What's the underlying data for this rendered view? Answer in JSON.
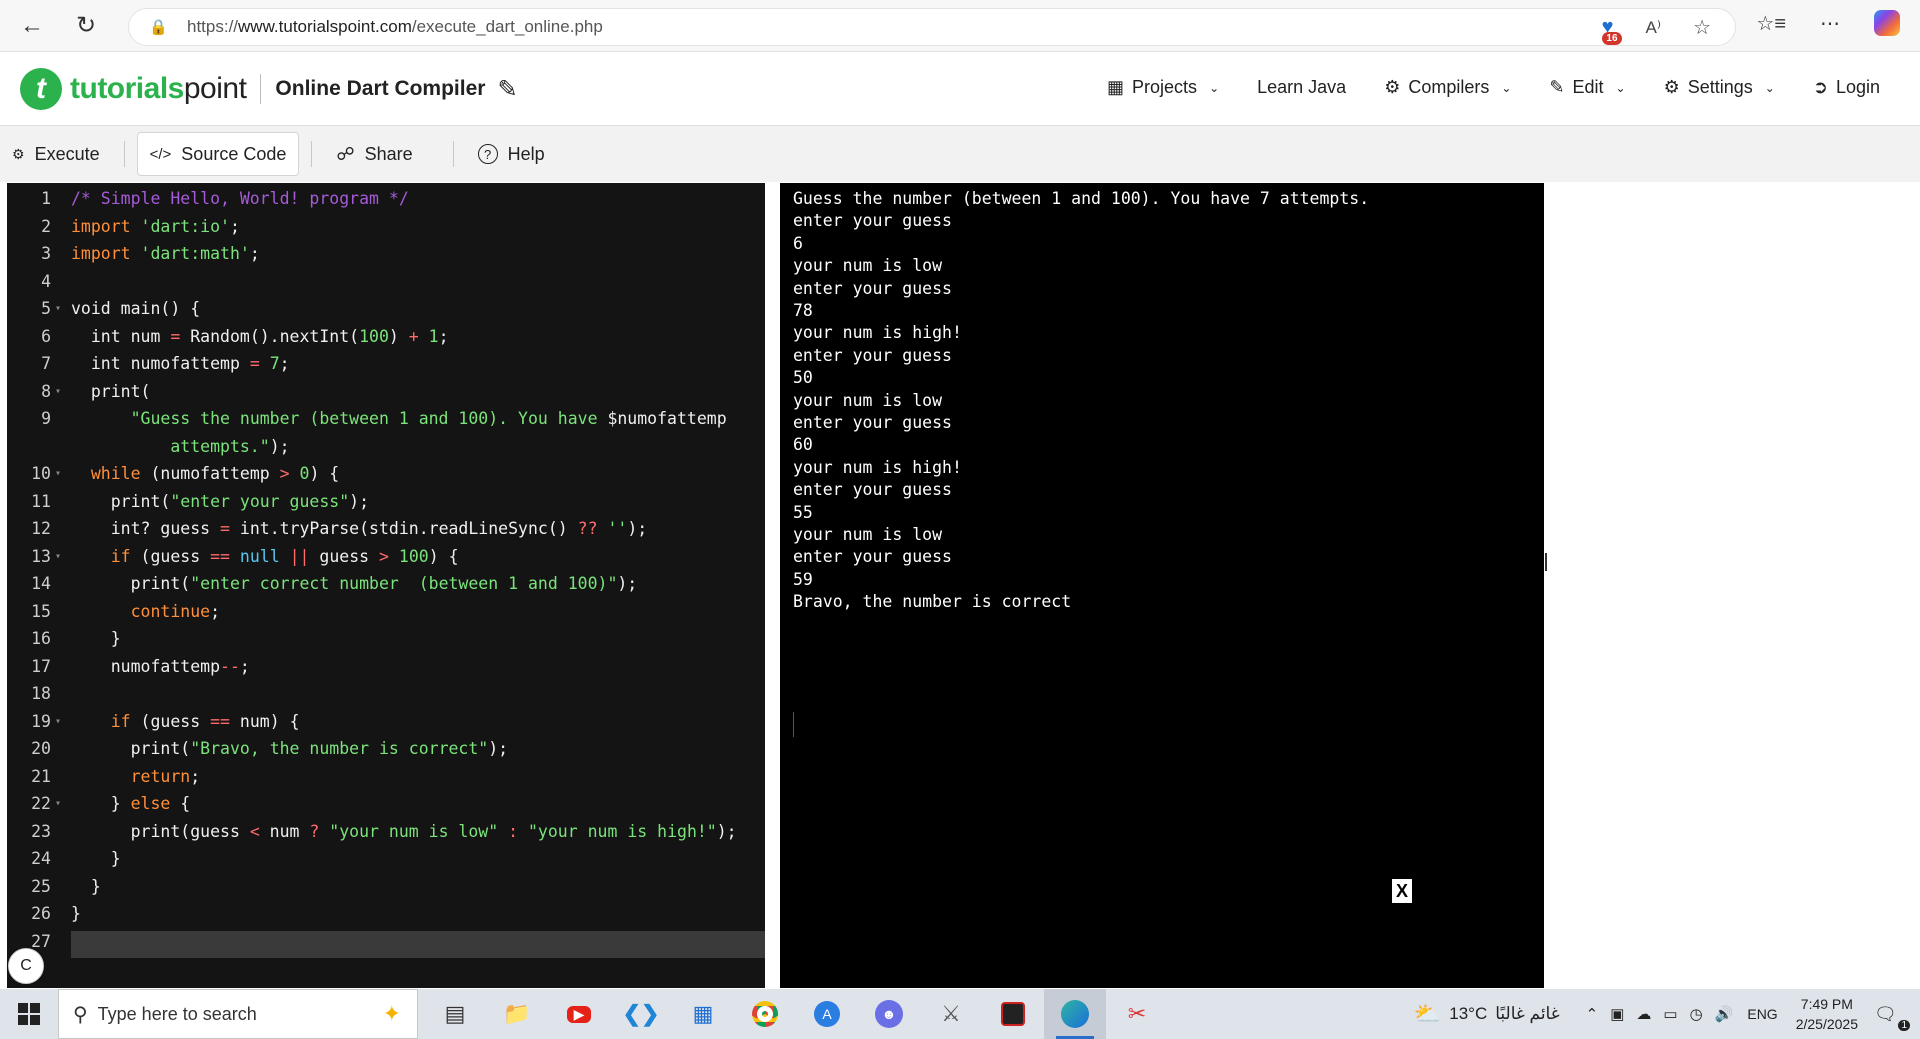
{
  "browser": {
    "url_prefix": "https://",
    "url_host": "www.tutorialspoint.com",
    "url_path": "/execute_dart_online.php",
    "extension_badge": "16"
  },
  "header": {
    "logo_main": "tutorials",
    "logo_second": "point",
    "title": "Online Dart Compiler",
    "menu": [
      {
        "label": "Projects",
        "icon": "grid-icon",
        "dropdown": true
      },
      {
        "label": "Learn Java",
        "icon": "",
        "dropdown": false
      },
      {
        "label": "Compilers",
        "icon": "compilers-icon",
        "dropdown": true
      },
      {
        "label": "Edit",
        "icon": "edit-icon",
        "dropdown": true
      },
      {
        "label": "Settings",
        "icon": "gear-icon",
        "dropdown": true
      },
      {
        "label": "Login",
        "icon": "login-icon",
        "dropdown": false
      }
    ]
  },
  "toolbar": {
    "execute": "Execute",
    "source_code": "Source Code",
    "share": "Share",
    "help": "Help"
  },
  "editor": {
    "line_numbers": [
      "1",
      "2",
      "3",
      "4",
      "5",
      "6",
      "7",
      "8",
      "9",
      "",
      "10",
      "11",
      "12",
      "13",
      "14",
      "15",
      "16",
      "17",
      "18",
      "19",
      "20",
      "21",
      "22",
      "23",
      "24",
      "25",
      "26",
      "27"
    ],
    "folds": [
      5,
      8,
      10,
      13,
      19,
      22
    ]
  },
  "output": {
    "lines": [
      "Guess the number (between 1 and 100). You have 7 attempts.",
      "enter your guess",
      "6",
      "your num is low",
      "enter your guess",
      "78",
      "your num is high!",
      "enter your guess",
      "50",
      "your num is low",
      "enter your guess",
      "60",
      "your num is high!",
      "enter your guess",
      "55",
      "your num is low",
      "enter your guess",
      "59",
      "Bravo, the number is correct"
    ],
    "close_label": "X"
  },
  "floating_button": "C",
  "taskbar": {
    "search_placeholder": "Type here to search",
    "weather": "13°C",
    "weather_text": "غائم غالبًا",
    "lang": "ENG",
    "time": "7:49 PM",
    "date": "2/25/2025",
    "notif_count": "1"
  },
  "colors": {
    "brand": "#2bb24c",
    "editor_bg": "#141414",
    "output_bg": "#000000"
  }
}
